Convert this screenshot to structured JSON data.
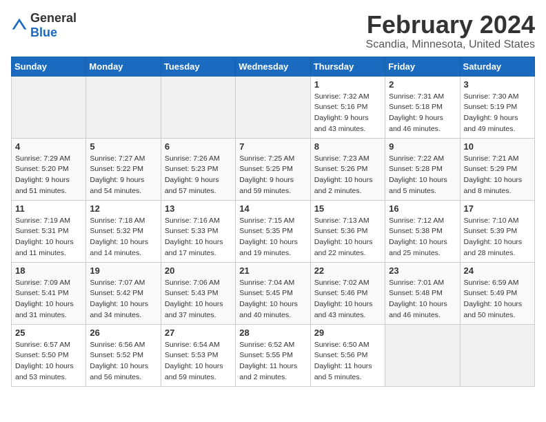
{
  "logo": {
    "text_general": "General",
    "text_blue": "Blue"
  },
  "title": "February 2024",
  "subtitle": "Scandia, Minnesota, United States",
  "days_of_week": [
    "Sunday",
    "Monday",
    "Tuesday",
    "Wednesday",
    "Thursday",
    "Friday",
    "Saturday"
  ],
  "weeks": [
    [
      {
        "day": "",
        "info": ""
      },
      {
        "day": "",
        "info": ""
      },
      {
        "day": "",
        "info": ""
      },
      {
        "day": "",
        "info": ""
      },
      {
        "day": "1",
        "info": "Sunrise: 7:32 AM\nSunset: 5:16 PM\nDaylight: 9 hours\nand 43 minutes."
      },
      {
        "day": "2",
        "info": "Sunrise: 7:31 AM\nSunset: 5:18 PM\nDaylight: 9 hours\nand 46 minutes."
      },
      {
        "day": "3",
        "info": "Sunrise: 7:30 AM\nSunset: 5:19 PM\nDaylight: 9 hours\nand 49 minutes."
      }
    ],
    [
      {
        "day": "4",
        "info": "Sunrise: 7:29 AM\nSunset: 5:20 PM\nDaylight: 9 hours\nand 51 minutes."
      },
      {
        "day": "5",
        "info": "Sunrise: 7:27 AM\nSunset: 5:22 PM\nDaylight: 9 hours\nand 54 minutes."
      },
      {
        "day": "6",
        "info": "Sunrise: 7:26 AM\nSunset: 5:23 PM\nDaylight: 9 hours\nand 57 minutes."
      },
      {
        "day": "7",
        "info": "Sunrise: 7:25 AM\nSunset: 5:25 PM\nDaylight: 9 hours\nand 59 minutes."
      },
      {
        "day": "8",
        "info": "Sunrise: 7:23 AM\nSunset: 5:26 PM\nDaylight: 10 hours\nand 2 minutes."
      },
      {
        "day": "9",
        "info": "Sunrise: 7:22 AM\nSunset: 5:28 PM\nDaylight: 10 hours\nand 5 minutes."
      },
      {
        "day": "10",
        "info": "Sunrise: 7:21 AM\nSunset: 5:29 PM\nDaylight: 10 hours\nand 8 minutes."
      }
    ],
    [
      {
        "day": "11",
        "info": "Sunrise: 7:19 AM\nSunset: 5:31 PM\nDaylight: 10 hours\nand 11 minutes."
      },
      {
        "day": "12",
        "info": "Sunrise: 7:18 AM\nSunset: 5:32 PM\nDaylight: 10 hours\nand 14 minutes."
      },
      {
        "day": "13",
        "info": "Sunrise: 7:16 AM\nSunset: 5:33 PM\nDaylight: 10 hours\nand 17 minutes."
      },
      {
        "day": "14",
        "info": "Sunrise: 7:15 AM\nSunset: 5:35 PM\nDaylight: 10 hours\nand 19 minutes."
      },
      {
        "day": "15",
        "info": "Sunrise: 7:13 AM\nSunset: 5:36 PM\nDaylight: 10 hours\nand 22 minutes."
      },
      {
        "day": "16",
        "info": "Sunrise: 7:12 AM\nSunset: 5:38 PM\nDaylight: 10 hours\nand 25 minutes."
      },
      {
        "day": "17",
        "info": "Sunrise: 7:10 AM\nSunset: 5:39 PM\nDaylight: 10 hours\nand 28 minutes."
      }
    ],
    [
      {
        "day": "18",
        "info": "Sunrise: 7:09 AM\nSunset: 5:41 PM\nDaylight: 10 hours\nand 31 minutes."
      },
      {
        "day": "19",
        "info": "Sunrise: 7:07 AM\nSunset: 5:42 PM\nDaylight: 10 hours\nand 34 minutes."
      },
      {
        "day": "20",
        "info": "Sunrise: 7:06 AM\nSunset: 5:43 PM\nDaylight: 10 hours\nand 37 minutes."
      },
      {
        "day": "21",
        "info": "Sunrise: 7:04 AM\nSunset: 5:45 PM\nDaylight: 10 hours\nand 40 minutes."
      },
      {
        "day": "22",
        "info": "Sunrise: 7:02 AM\nSunset: 5:46 PM\nDaylight: 10 hours\nand 43 minutes."
      },
      {
        "day": "23",
        "info": "Sunrise: 7:01 AM\nSunset: 5:48 PM\nDaylight: 10 hours\nand 46 minutes."
      },
      {
        "day": "24",
        "info": "Sunrise: 6:59 AM\nSunset: 5:49 PM\nDaylight: 10 hours\nand 50 minutes."
      }
    ],
    [
      {
        "day": "25",
        "info": "Sunrise: 6:57 AM\nSunset: 5:50 PM\nDaylight: 10 hours\nand 53 minutes."
      },
      {
        "day": "26",
        "info": "Sunrise: 6:56 AM\nSunset: 5:52 PM\nDaylight: 10 hours\nand 56 minutes."
      },
      {
        "day": "27",
        "info": "Sunrise: 6:54 AM\nSunset: 5:53 PM\nDaylight: 10 hours\nand 59 minutes."
      },
      {
        "day": "28",
        "info": "Sunrise: 6:52 AM\nSunset: 5:55 PM\nDaylight: 11 hours\nand 2 minutes."
      },
      {
        "day": "29",
        "info": "Sunrise: 6:50 AM\nSunset: 5:56 PM\nDaylight: 11 hours\nand 5 minutes."
      },
      {
        "day": "",
        "info": ""
      },
      {
        "day": "",
        "info": ""
      }
    ]
  ]
}
